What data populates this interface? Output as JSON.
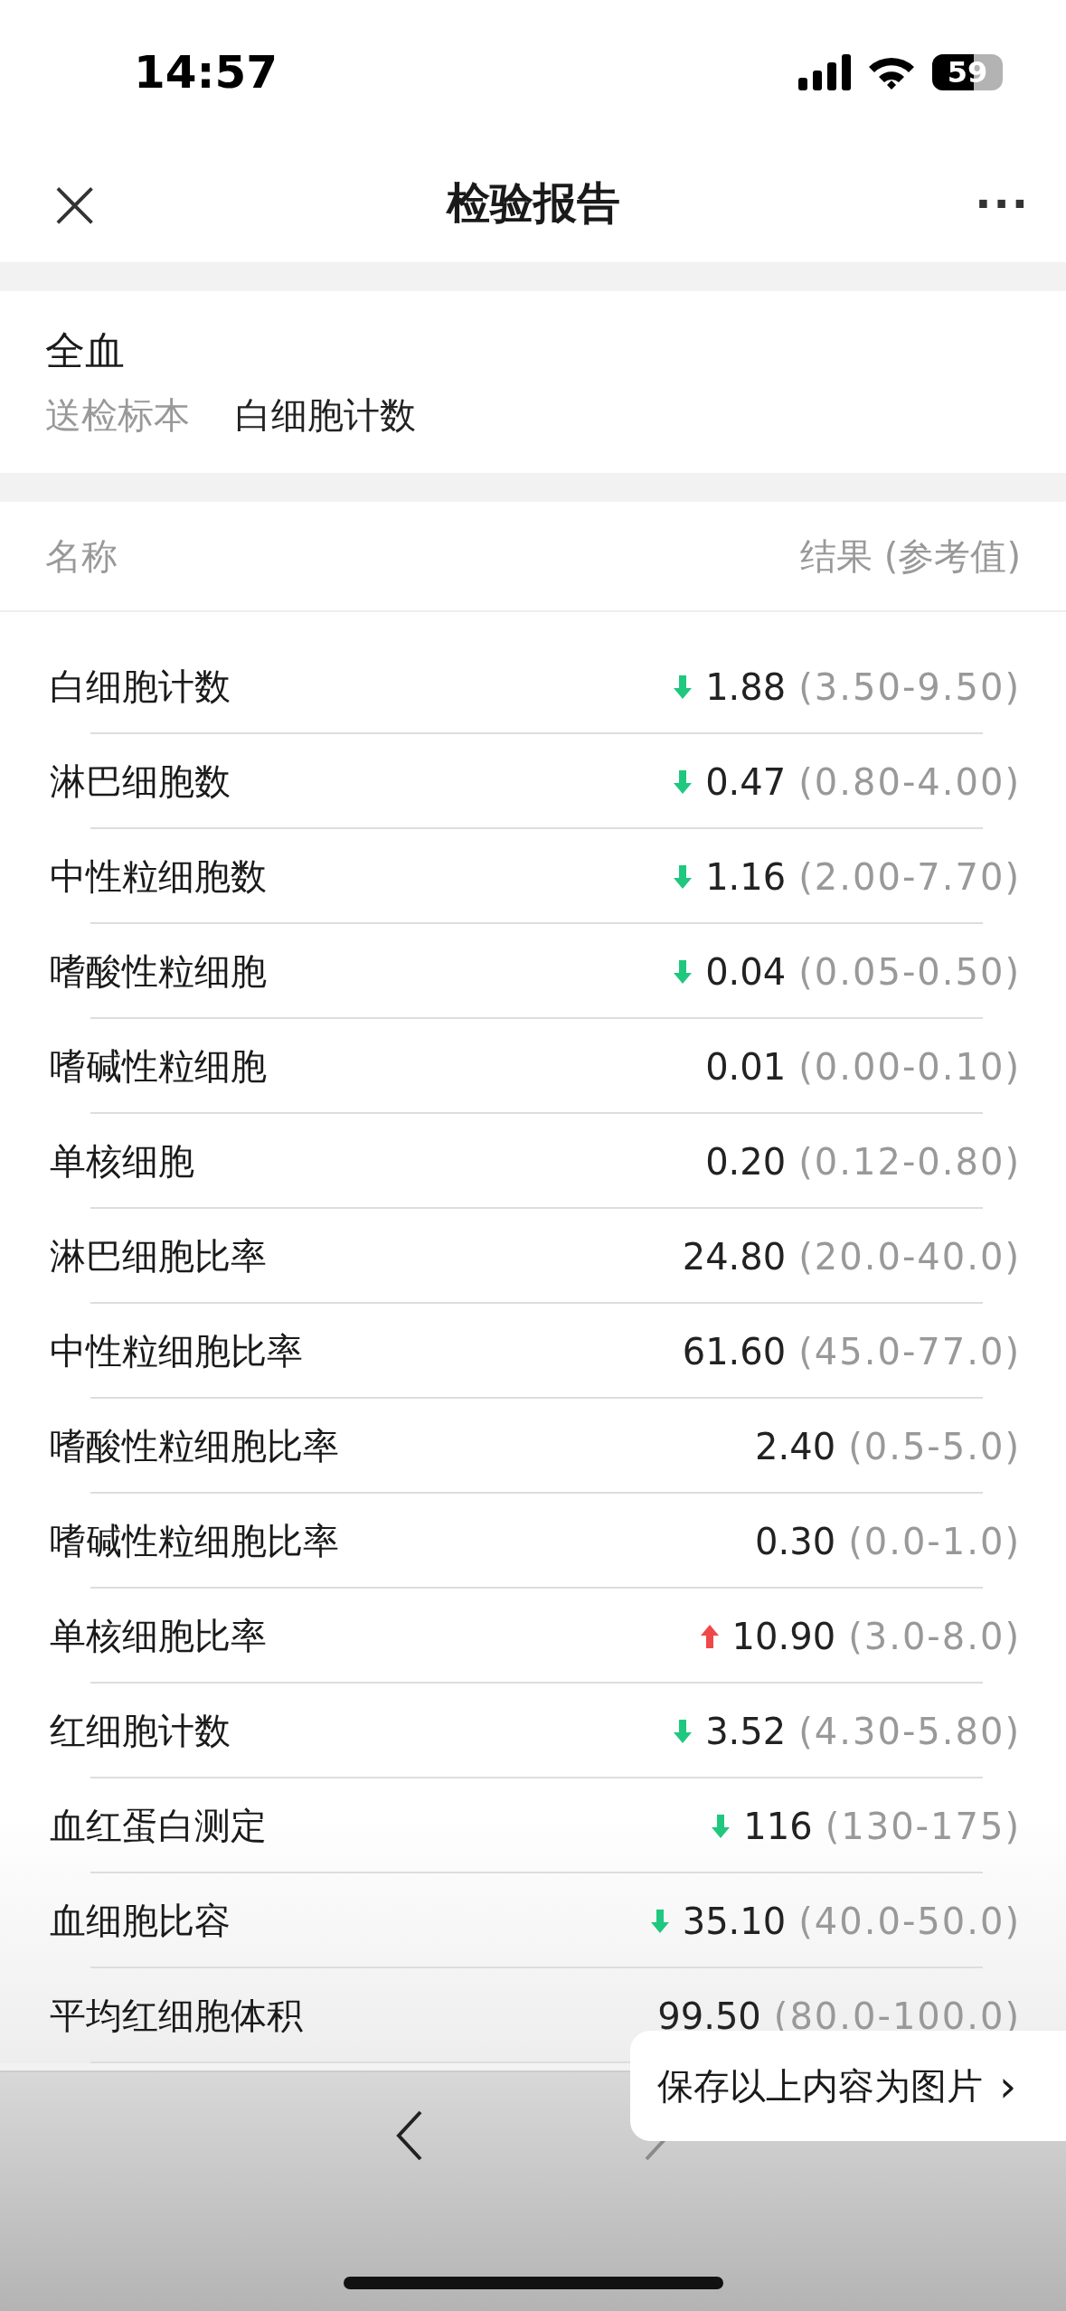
{
  "status_bar": {
    "time": "14:57",
    "battery": "59"
  },
  "nav_bar": {
    "close": "×",
    "title": "检验报告",
    "more": "···"
  },
  "specimen": {
    "type": "全血",
    "label": "送检标本",
    "value": "白细胞计数"
  },
  "table": {
    "columns": [
      "名称",
      "结果 (参考值)"
    ],
    "rows": [
      {
        "name": "白细胞计数",
        "kind": "low",
        "value": "1.88",
        "range": "(3.50-9.50)"
      },
      {
        "name": "淋巴细胞数",
        "kind": "low",
        "value": "0.47",
        "range": "(0.80-4.00)"
      },
      {
        "name": "中性粒细胞数",
        "kind": "low",
        "value": "1.16",
        "range": "(2.00-7.70)"
      },
      {
        "name": "嗜酸性粒细胞",
        "kind": "low",
        "value": "0.04",
        "range": "(0.05-0.50)"
      },
      {
        "name": "嗜碱性粒细胞",
        "kind": "normal",
        "value": "0.01",
        "range": "(0.00-0.10)"
      },
      {
        "name": "单核细胞",
        "kind": "normal",
        "value": "0.20",
        "range": "(0.12-0.80)"
      },
      {
        "name": "淋巴细胞比率",
        "kind": "normal",
        "value": "24.80",
        "range": "(20.0-40.0)"
      },
      {
        "name": "中性粒细胞比率",
        "kind": "normal",
        "value": "61.60",
        "range": "(45.0-77.0)"
      },
      {
        "name": "嗜酸性粒细胞比率",
        "kind": "normal",
        "value": "2.40",
        "range": "(0.5-5.0)"
      },
      {
        "name": "嗜碱性粒细胞比率",
        "kind": "normal",
        "value": "0.30",
        "range": "(0.0-1.0)"
      },
      {
        "name": "单核细胞比率",
        "kind": "high",
        "value": "10.90",
        "range": "(3.0-8.0)"
      },
      {
        "name": "红细胞计数",
        "kind": "low",
        "value": "3.52",
        "range": "(4.30-5.80)"
      },
      {
        "name": "血红蛋白测定",
        "kind": "low",
        "value": "116",
        "range": "(130-175)"
      },
      {
        "name": "血细胞比容",
        "kind": "low",
        "value": "35.10",
        "range": "(40.0-50.0)"
      },
      {
        "name": "平均红细胞体积",
        "kind": "normal",
        "value": "99.50",
        "range": "(80.0-100.0)"
      }
    ]
  },
  "toolbar": {
    "back_disabled": false,
    "forward_disabled": true
  },
  "save_popup": {
    "label": "保存以上内容为图片",
    "chevron": "›"
  }
}
